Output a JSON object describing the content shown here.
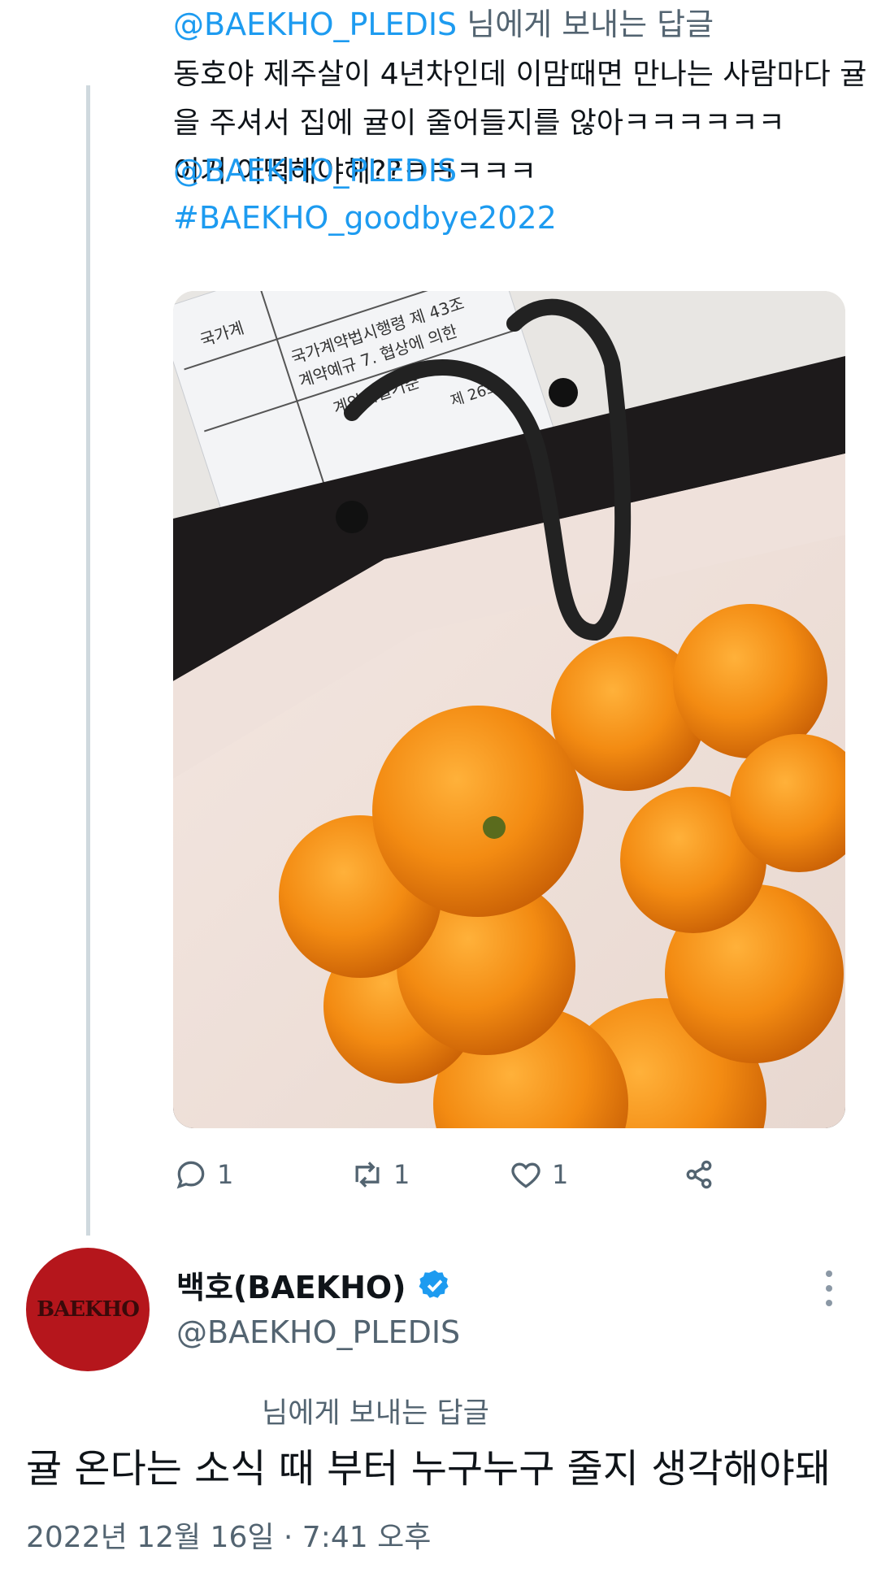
{
  "parent_tweet": {
    "reply_mention": "@BAEKHO_PLEDIS",
    "reply_suffix": " 님에게 보내는 답글",
    "text_lines": [
      "동호야 제주살이 4년차인데 이맘때면 만나는 사람마다 귤",
      "을 주셔서 집에 귤이 줄어들지를 않아ㅋㅋㅋㅋㅋㅋ",
      "이거 어떡해야해??ㅋㅋㅋㅋㅋ"
    ],
    "mention_line": "@BAEKHO_PLEDIS",
    "hashtag_line": "#BAEKHO_goodbye2022",
    "photo_description_icon": "tangerines-in-paper-bag",
    "paper_text": [
      "국가계약법시행령 제 43조",
      "계약예규 7. 협상에 의한",
      "계약체결기준",
      "국가계",
      "제 26조"
    ],
    "actions": {
      "reply_count": "1",
      "retweet_count": "1",
      "like_count": "1"
    }
  },
  "reply_tweet": {
    "avatar_text": "BAEKHO",
    "display_name": "백호(BAEKHO)",
    "handle": "@BAEKHO_PLEDIS",
    "replying_to": "님에게 보내는 답글",
    "text": "귤 온다는 소식 때 부터 누구누구 줄지 생각해야돼",
    "timestamp": "2022년 12월 16일 · 7:41 오후"
  },
  "colors": {
    "accent": "#1d9bf0",
    "muted": "#536471",
    "thread_line": "#cfd9de",
    "avatar_bg": "#b5161c"
  }
}
